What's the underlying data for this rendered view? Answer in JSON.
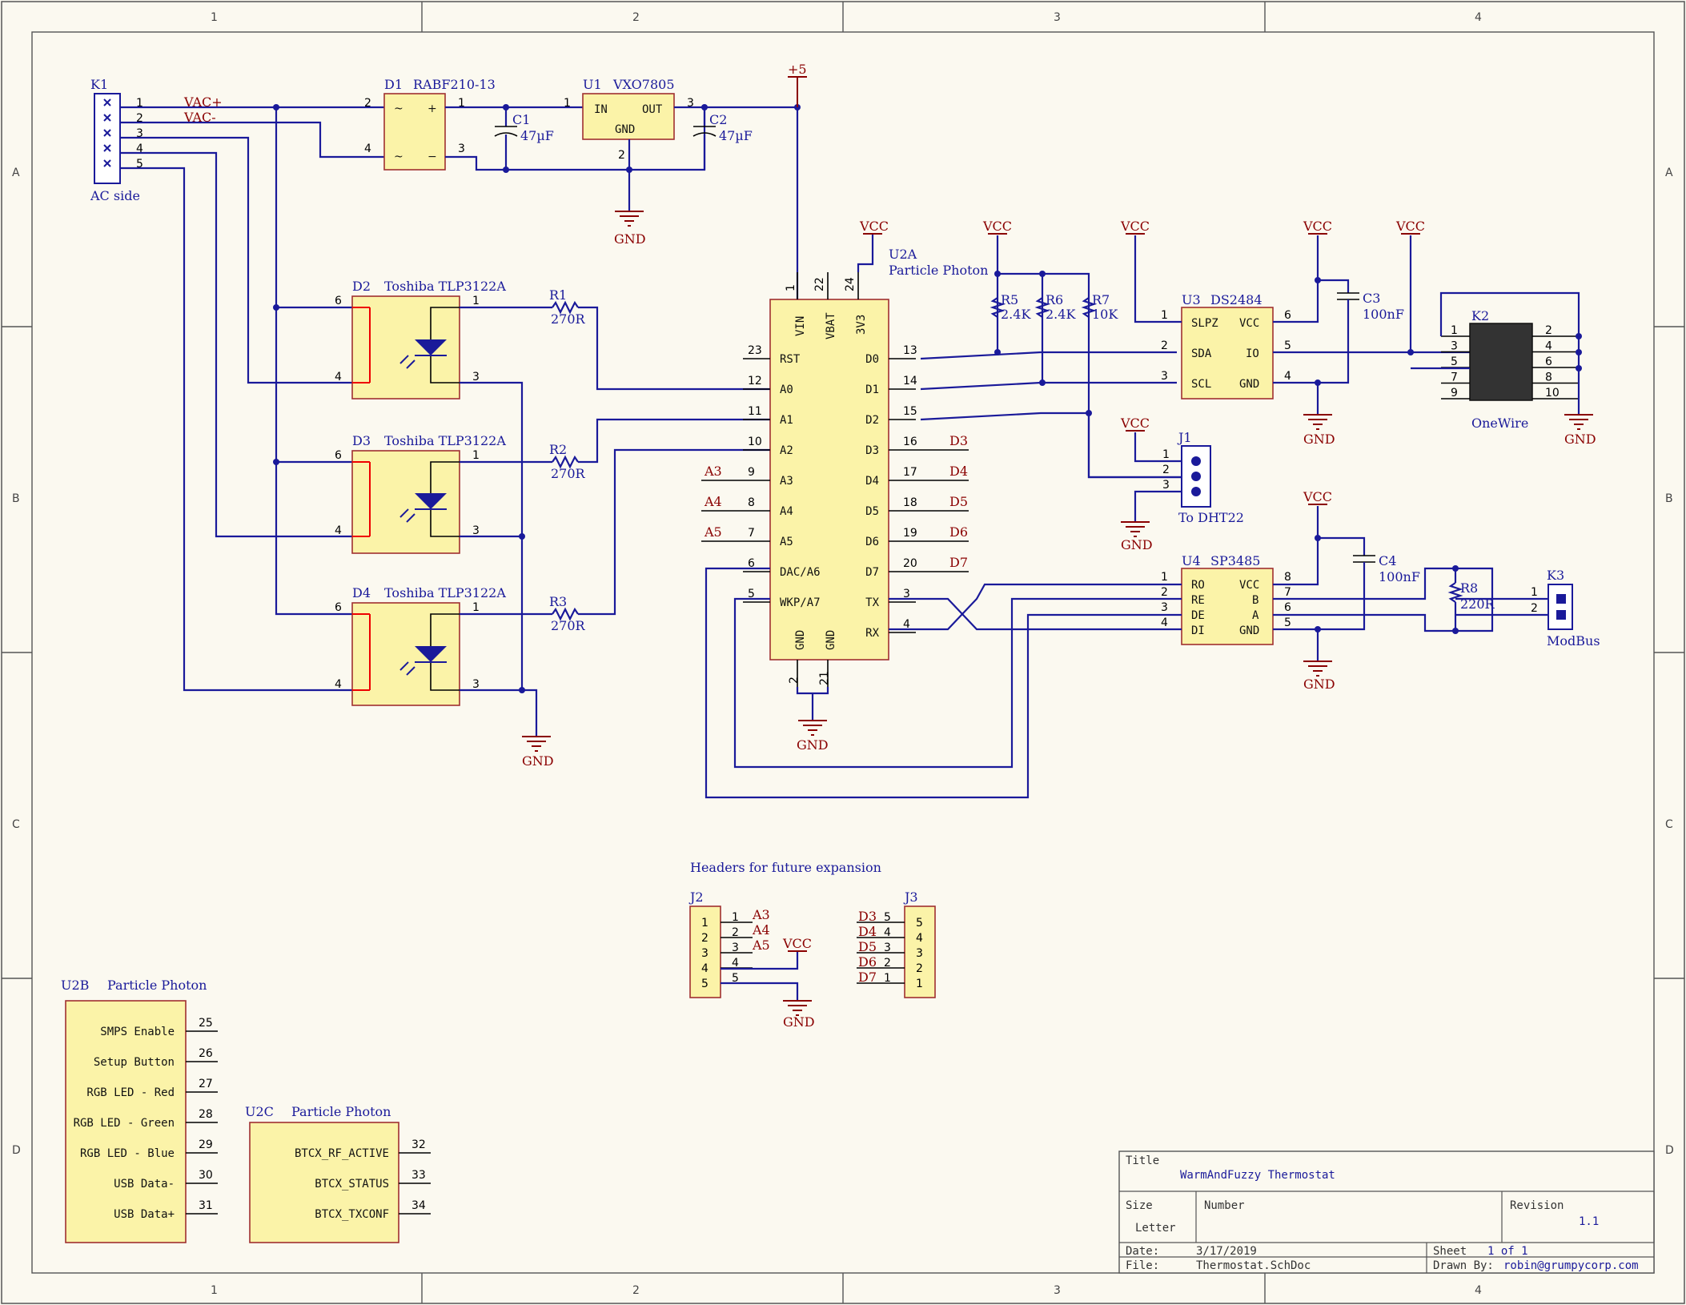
{
  "zones": {
    "cols": [
      "1",
      "2",
      "3",
      "4"
    ],
    "rows": [
      "A",
      "B",
      "C",
      "D"
    ]
  },
  "k1": {
    "ref": "K1",
    "desc": "AC side",
    "pins": [
      "1",
      "2",
      "3",
      "4",
      "5"
    ],
    "net1": "VAC+",
    "net2": "VAC-"
  },
  "d1": {
    "ref": "D1",
    "value": "RABF210-13",
    "sym_ac": "~",
    "sym_plus": "+",
    "sym_minus": "−",
    "pins": [
      "2",
      "1",
      "4",
      "3"
    ]
  },
  "c1": {
    "ref": "C1",
    "value": "47µF"
  },
  "c2": {
    "ref": "C2",
    "value": "47µF"
  },
  "u1": {
    "ref": "U1",
    "value": "VXO7805",
    "in": "IN",
    "out": "OUT",
    "gnd": "GND",
    "pins": [
      "1",
      "3",
      "2"
    ]
  },
  "power": {
    "p5": "+5",
    "vcc": "VCC",
    "gnd": "GND"
  },
  "opto": [
    {
      "ref": "D2",
      "value": "Toshiba TLP3122A",
      "pins": [
        "6",
        "1",
        "4",
        "3"
      ],
      "rref": "R1",
      "rval": "270R"
    },
    {
      "ref": "D3",
      "value": "Toshiba TLP3122A",
      "pins": [
        "6",
        "1",
        "4",
        "3"
      ],
      "rref": "R2",
      "rval": "270R"
    },
    {
      "ref": "D4",
      "value": "Toshiba TLP3122A",
      "pins": [
        "6",
        "1",
        "4",
        "3"
      ],
      "rref": "R3",
      "rval": "270R"
    }
  ],
  "u2a": {
    "ref": "U2A",
    "value": "Particle Photon",
    "top_pins": [
      {
        "n": "1",
        "l": "VIN"
      },
      {
        "n": "22",
        "l": "VBAT"
      },
      {
        "n": "24",
        "l": "3V3"
      }
    ],
    "left": [
      {
        "n": "23",
        "l": "RST"
      },
      {
        "n": "12",
        "l": "A0"
      },
      {
        "n": "11",
        "l": "A1"
      },
      {
        "n": "10",
        "l": "A2"
      },
      {
        "n": "9",
        "l": "A3"
      },
      {
        "n": "8",
        "l": "A4"
      },
      {
        "n": "7",
        "l": "A5"
      },
      {
        "n": "6",
        "l": "DAC/A6"
      },
      {
        "n": "5",
        "l": "WKP/A7"
      }
    ],
    "right": [
      {
        "n": "13",
        "l": "D0"
      },
      {
        "n": "14",
        "l": "D1"
      },
      {
        "n": "15",
        "l": "D2"
      },
      {
        "n": "16",
        "l": "D3"
      },
      {
        "n": "17",
        "l": "D4"
      },
      {
        "n": "18",
        "l": "D5"
      },
      {
        "n": "19",
        "l": "D6"
      },
      {
        "n": "20",
        "l": "D7"
      },
      {
        "n": "3",
        "l": "TX"
      },
      {
        "n": "4",
        "l": "RX"
      }
    ],
    "bottom": [
      {
        "n": "2",
        "l": "GND"
      },
      {
        "n": "21",
        "l": "GND"
      }
    ],
    "left_nets": [
      "A3",
      "A4",
      "A5"
    ],
    "right_nets": [
      "D3",
      "D4",
      "D5",
      "D6",
      "D7"
    ]
  },
  "pullups": [
    {
      "ref": "R5",
      "value": "2.4K"
    },
    {
      "ref": "R6",
      "value": "2.4K"
    },
    {
      "ref": "R7",
      "value": "10K"
    }
  ],
  "u3": {
    "ref": "U3",
    "value": "DS2484",
    "left": [
      {
        "n": "1",
        "l": "SLPZ"
      },
      {
        "n": "2",
        "l": "SDA"
      },
      {
        "n": "3",
        "l": "SCL"
      }
    ],
    "right": [
      {
        "n": "6",
        "l": "VCC"
      },
      {
        "n": "5",
        "l": "IO"
      },
      {
        "n": "4",
        "l": "GND"
      }
    ]
  },
  "c3": {
    "ref": "C3",
    "value": "100nF"
  },
  "k2": {
    "ref": "K2",
    "desc": "OneWire",
    "pins_l": [
      "1",
      "3",
      "5",
      "7",
      "9"
    ],
    "pins_r": [
      "2",
      "4",
      "6",
      "8",
      "10"
    ]
  },
  "j1": {
    "ref": "J1",
    "desc": "To DHT22",
    "pins": [
      "1",
      "2",
      "3"
    ]
  },
  "u4": {
    "ref": "U4",
    "value": "SP3485",
    "left": [
      {
        "n": "1",
        "l": "RO"
      },
      {
        "n": "2",
        "l": "RE"
      },
      {
        "n": "3",
        "l": "DE"
      },
      {
        "n": "4",
        "l": "DI"
      }
    ],
    "right": [
      {
        "n": "8",
        "l": "VCC"
      },
      {
        "n": "7",
        "l": "B"
      },
      {
        "n": "6",
        "l": "A"
      },
      {
        "n": "5",
        "l": "GND"
      }
    ]
  },
  "c4": {
    "ref": "C4",
    "value": "100nF"
  },
  "r8": {
    "ref": "R8",
    "value": "220R"
  },
  "k3": {
    "ref": "K3",
    "desc": "ModBus",
    "pins": [
      "1",
      "2"
    ]
  },
  "headers_note": "Headers for future expansion",
  "j2": {
    "ref": "J2",
    "pins": [
      "1",
      "2",
      "3",
      "4",
      "5"
    ],
    "nets": [
      "A3",
      "A4",
      "A5"
    ]
  },
  "j3": {
    "ref": "J3",
    "pins": [
      "5",
      "4",
      "3",
      "2",
      "1"
    ],
    "nets": [
      "D3",
      "D4",
      "D5",
      "D6",
      "D7"
    ]
  },
  "u2b": {
    "ref": "U2B",
    "value": "Particle Photon",
    "pins": [
      {
        "n": "25",
        "l": "SMPS Enable"
      },
      {
        "n": "26",
        "l": "Setup Button"
      },
      {
        "n": "27",
        "l": "RGB LED - Red"
      },
      {
        "n": "28",
        "l": "RGB LED - Green"
      },
      {
        "n": "29",
        "l": "RGB LED - Blue"
      },
      {
        "n": "30",
        "l": "USB Data-"
      },
      {
        "n": "31",
        "l": "USB Data+"
      }
    ]
  },
  "u2c": {
    "ref": "U2C",
    "value": "Particle Photon",
    "pins": [
      {
        "n": "32",
        "l": "BTCX_RF_ACTIVE"
      },
      {
        "n": "33",
        "l": "BTCX_STATUS"
      },
      {
        "n": "34",
        "l": "BTCX_TXCONF"
      }
    ]
  },
  "titleblock": {
    "title_label": "Title",
    "title": "WarmAndFuzzy Thermostat",
    "size_label": "Size",
    "size": "Letter",
    "number_label": "Number",
    "number": "",
    "revision_label": "Revision",
    "revision": "1.1",
    "date_label": "Date:",
    "date": "3/17/2019",
    "sheet_label": "Sheet",
    "sheet": "1 of 1",
    "file_label": "File:",
    "file": "Thermostat.SchDoc",
    "drawn_label": "Drawn By:",
    "drawn": "robin@grumpycorp.com"
  }
}
